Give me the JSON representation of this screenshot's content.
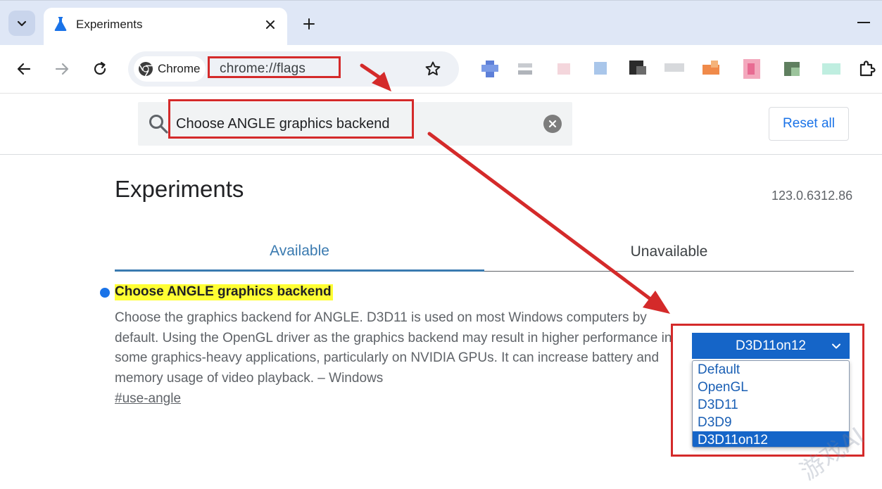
{
  "browser": {
    "tab_title": "Experiments",
    "chip_label": "Chrome",
    "url": "chrome://flags"
  },
  "flags_page": {
    "search_value": "Choose ANGLE graphics backend",
    "reset_label": "Reset all",
    "title": "Experiments",
    "version": "123.0.6312.86",
    "tabs": [
      {
        "label": "Available",
        "active": true
      },
      {
        "label": "Unavailable",
        "active": false
      }
    ],
    "flag": {
      "name": "Choose ANGLE graphics backend",
      "description": "Choose the graphics backend for ANGLE. D3D11 is used on most Windows computers by default. Using the OpenGL driver as the graphics backend may result in higher performance in some graphics-heavy applications, particularly on NVIDIA GPUs. It can increase battery and memory usage of video playback. – Windows",
      "link": "#use-angle",
      "selected": "D3D11on12",
      "options": [
        "Default",
        "OpenGL",
        "D3D11",
        "D3D9",
        "D3D11on12"
      ]
    }
  },
  "colors": {
    "accent": "#1a73e8",
    "highlight": "#ffff33",
    "annotation": "#d42a2a",
    "select_bg": "#1565c8"
  },
  "icons": [
    "tab-search-icon",
    "flask-icon",
    "close-icon",
    "plus-icon",
    "minimize-icon",
    "back-arrow-icon",
    "forward-arrow-icon",
    "reload-icon",
    "chrome-logo-icon",
    "star-icon",
    "puzzle-icon",
    "search-icon",
    "clear-icon",
    "chevron-down-icon"
  ],
  "watermark": "游戏AI"
}
